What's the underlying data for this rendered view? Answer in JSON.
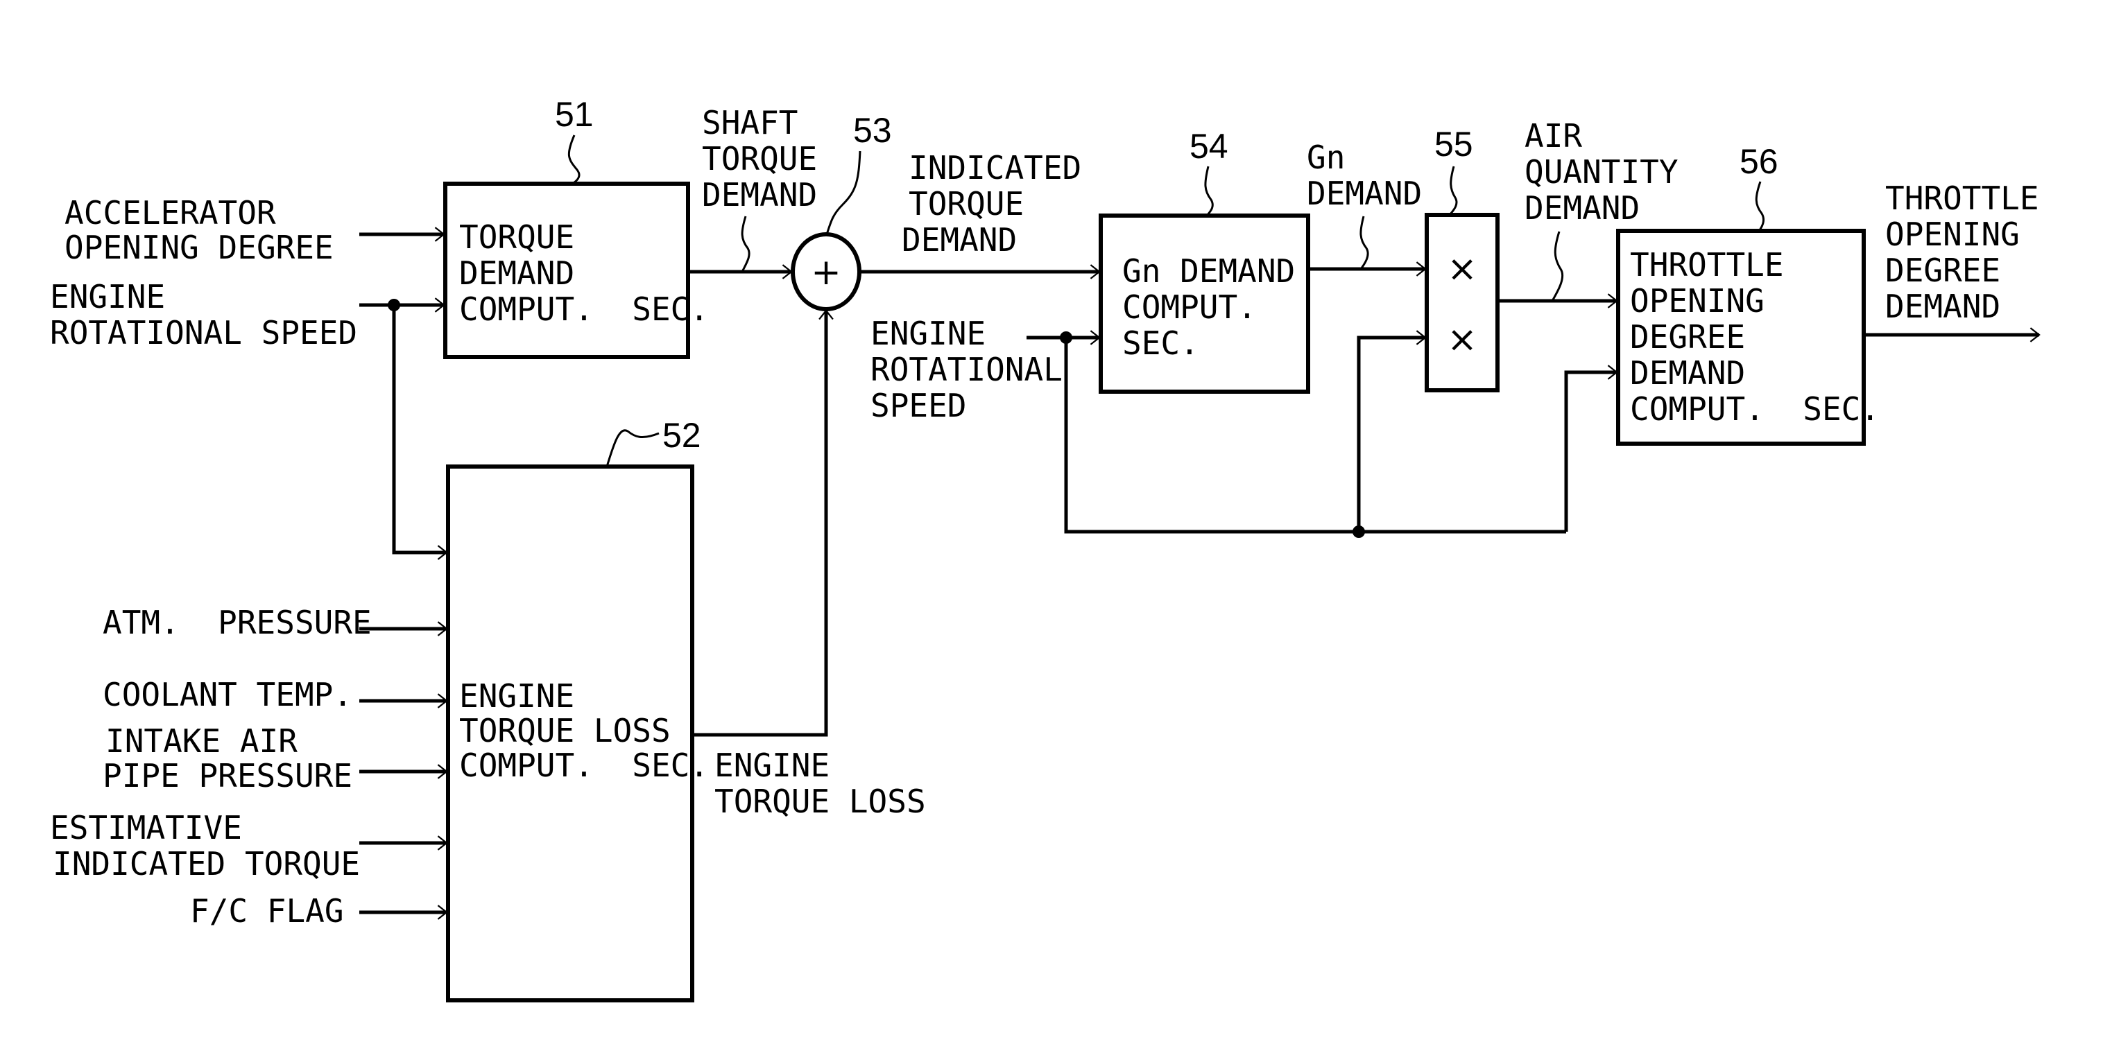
{
  "figure": {
    "blocks": [
      {
        "ref": "51",
        "lines": [
          "TORQUE",
          "DEMAND",
          "COMPUT.  SEC."
        ]
      },
      {
        "ref": "52",
        "lines": [
          "ENGINE",
          "TORQUE LOSS",
          "COMPUT.  SEC."
        ]
      },
      {
        "ref": "53",
        "symbol": "+"
      },
      {
        "ref": "54",
        "lines": [
          "Gn DEMAND",
          "COMPUT.",
          "SEC."
        ]
      },
      {
        "ref": "55",
        "symbols": [
          "×",
          "×"
        ]
      },
      {
        "ref": "56",
        "lines": [
          "THROTTLE",
          "OPENING",
          "DEGREE",
          "DEMAND",
          "COMPUT.  SEC."
        ]
      }
    ],
    "inputs": {
      "accelerator": [
        "ACCELERATOR",
        "OPENING DEGREE"
      ],
      "engine_speed_left": [
        "ENGINE",
        "ROTATIONAL SPEED"
      ],
      "atm_pressure": [
        "ATM.  PRESSURE"
      ],
      "coolant_temp": [
        "COOLANT TEMP."
      ],
      "intake_air": [
        "INTAKE AIR",
        "PIPE PRESSURE"
      ],
      "estimative": [
        "ESTIMATIVE",
        "INDICATED TORQUE"
      ],
      "fc_flag": [
        "F/C FLAG"
      ],
      "engine_speed_mid": [
        "ENGINE",
        "ROTATIONAL",
        "SPEED"
      ]
    },
    "signals": {
      "shaft_torque": [
        "SHAFT",
        "TORQUE",
        "DEMAND"
      ],
      "indicated_torque": [
        "INDICATED",
        "TORQUE",
        "DEMAND"
      ],
      "engine_torque_loss": [
        "ENGINE",
        "TORQUE LOSS"
      ],
      "gn_demand": [
        "Gn",
        "DEMAND"
      ],
      "air_quantity": [
        "AIR",
        "QUANTITY",
        "DEMAND"
      ],
      "throttle_output": [
        "THROTTLE",
        "OPENING",
        "DEGREE",
        "DEMAND"
      ]
    }
  }
}
